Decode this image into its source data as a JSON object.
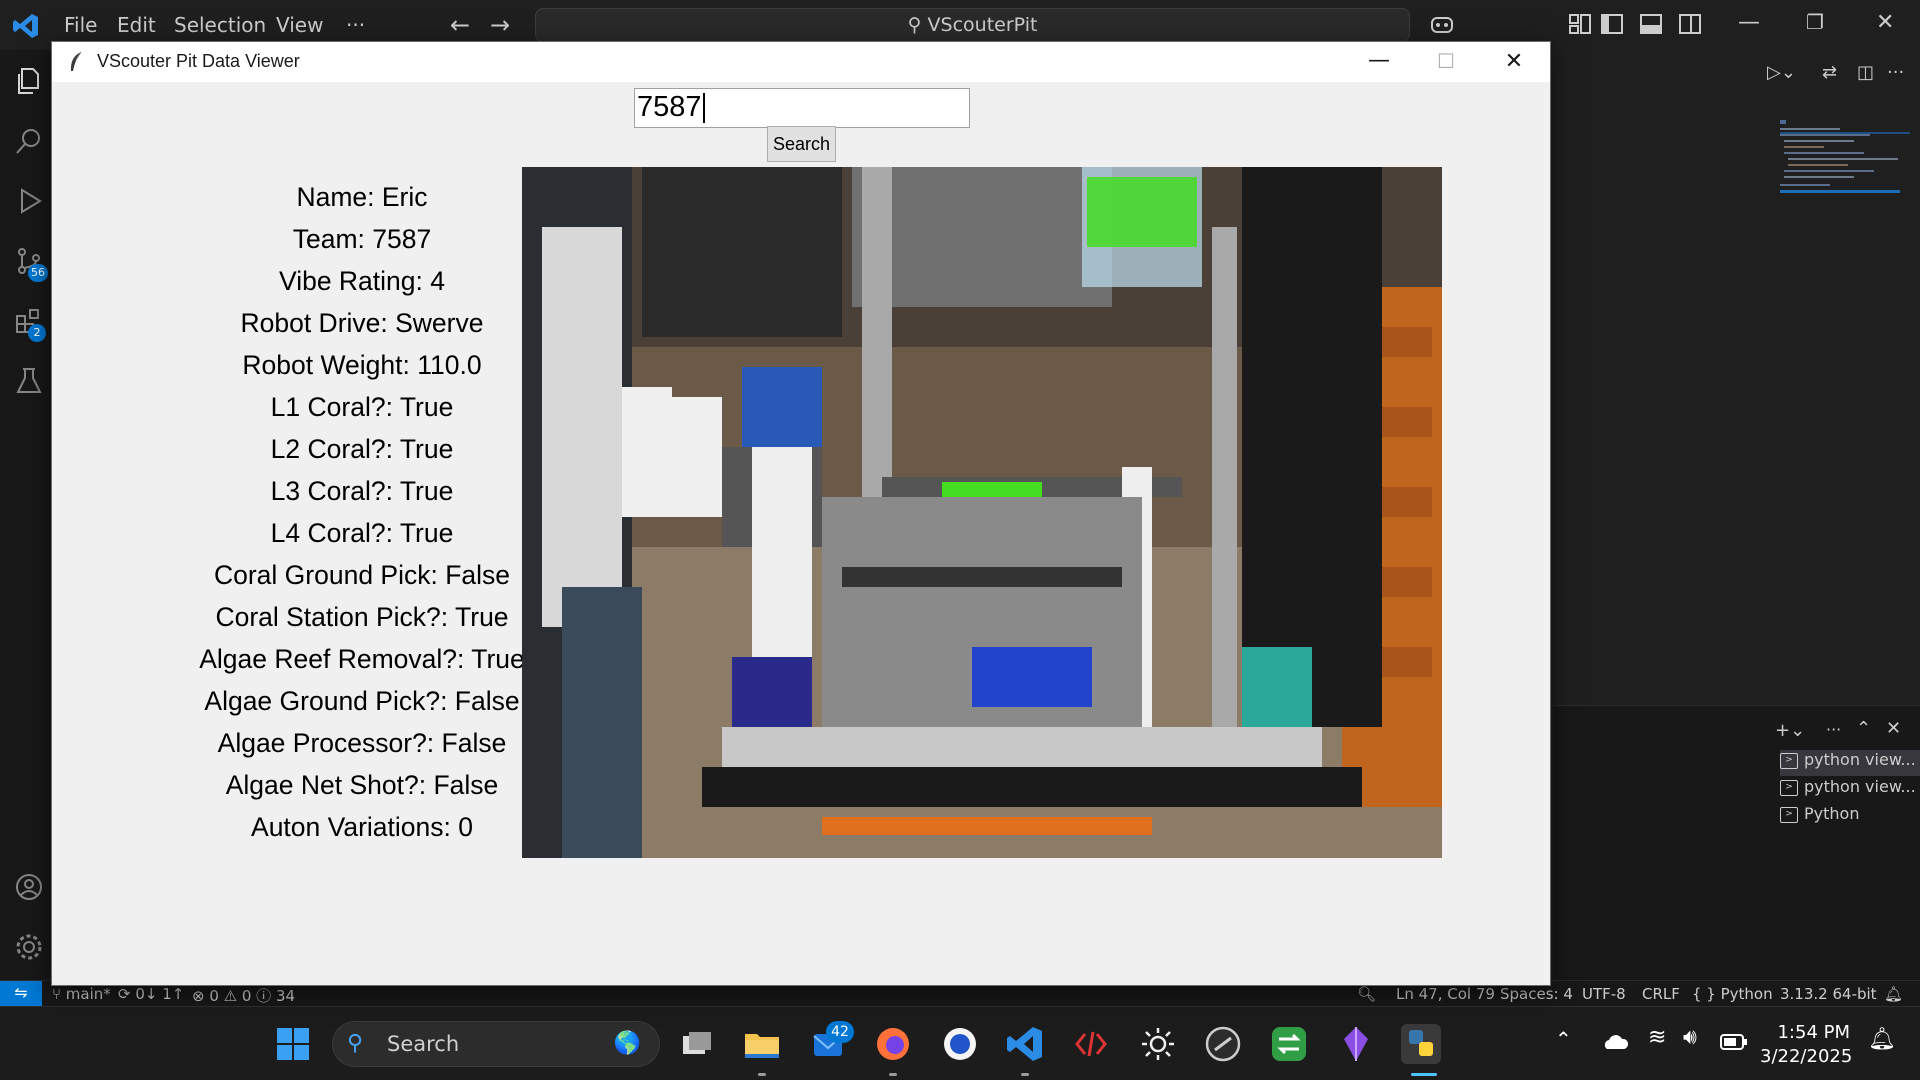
{
  "vscode": {
    "menu": [
      "File",
      "Edit",
      "Selection",
      "View",
      "···"
    ],
    "command_center": "VScouterPit",
    "badges": {
      "source_control": "56",
      "extensions": "2"
    },
    "terminals": [
      "python view...",
      "python view...",
      "Python"
    ]
  },
  "status_bar": {
    "branch": "main*",
    "sync": "0↓ 1↑",
    "problems": "⊗ 0 ⚠ 0 ⓘ 34",
    "position": "Ln 47, Col 79",
    "spaces": "Spaces: 4",
    "encoding": "UTF-8",
    "eol": "CRLF",
    "language": "{ } Python",
    "interpreter": "3.13.2 64-bit"
  },
  "taskbar": {
    "search_label": "Search",
    "mail_badge": "42",
    "time": "1:54 PM",
    "date": "3/22/2025"
  },
  "app": {
    "title": "VScouter Pit Data Viewer",
    "search_value": "7587",
    "search_button": "Search",
    "fields": [
      "Name: Eric",
      "Team: 7587",
      "Vibe Rating: 4",
      "Robot Drive: Swerve",
      "Robot Weight: 110.0",
      "L1 Coral?: True",
      "L2 Coral?: True",
      "L3 Coral?: True",
      "L4 Coral?: True",
      "Coral Ground Pick: False",
      "Coral Station Pick?: True",
      "Algae Reef Removal?: True",
      "Algae Ground Pick?: False",
      "Algae Processor?: False",
      "Algae Net Shot?: False",
      "Auton Variations: 0"
    ]
  },
  "colors": {
    "accent": "#0078d4",
    "window_bg": "#f0f0f0",
    "editor_bg": "#1f1f1f"
  }
}
